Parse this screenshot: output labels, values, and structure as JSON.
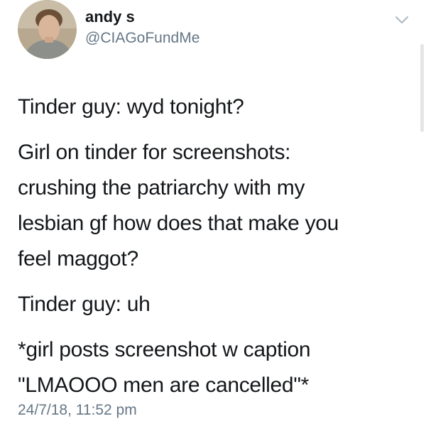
{
  "author": {
    "display_name": "andy s",
    "handle": "@CIAGoFundMe"
  },
  "icons": {
    "menu": "chevron-down-icon"
  },
  "tweet": {
    "paragraphs": [
      "Tinder guy: wyd tonight?",
      "Girl on tinder for screenshots:\ncrushing the patriarchy with my\nlesbian gf how does that make you\nfeel maggot?",
      "Tinder guy: uh",
      "*girl posts screenshot w caption\n\"LMAOOO men are cancelled\"*"
    ],
    "timestamp": "24/7/18, 11:52 pm"
  },
  "colors": {
    "text": "#14171a",
    "secondary": "#657786",
    "chevron": "#aab8c2"
  }
}
